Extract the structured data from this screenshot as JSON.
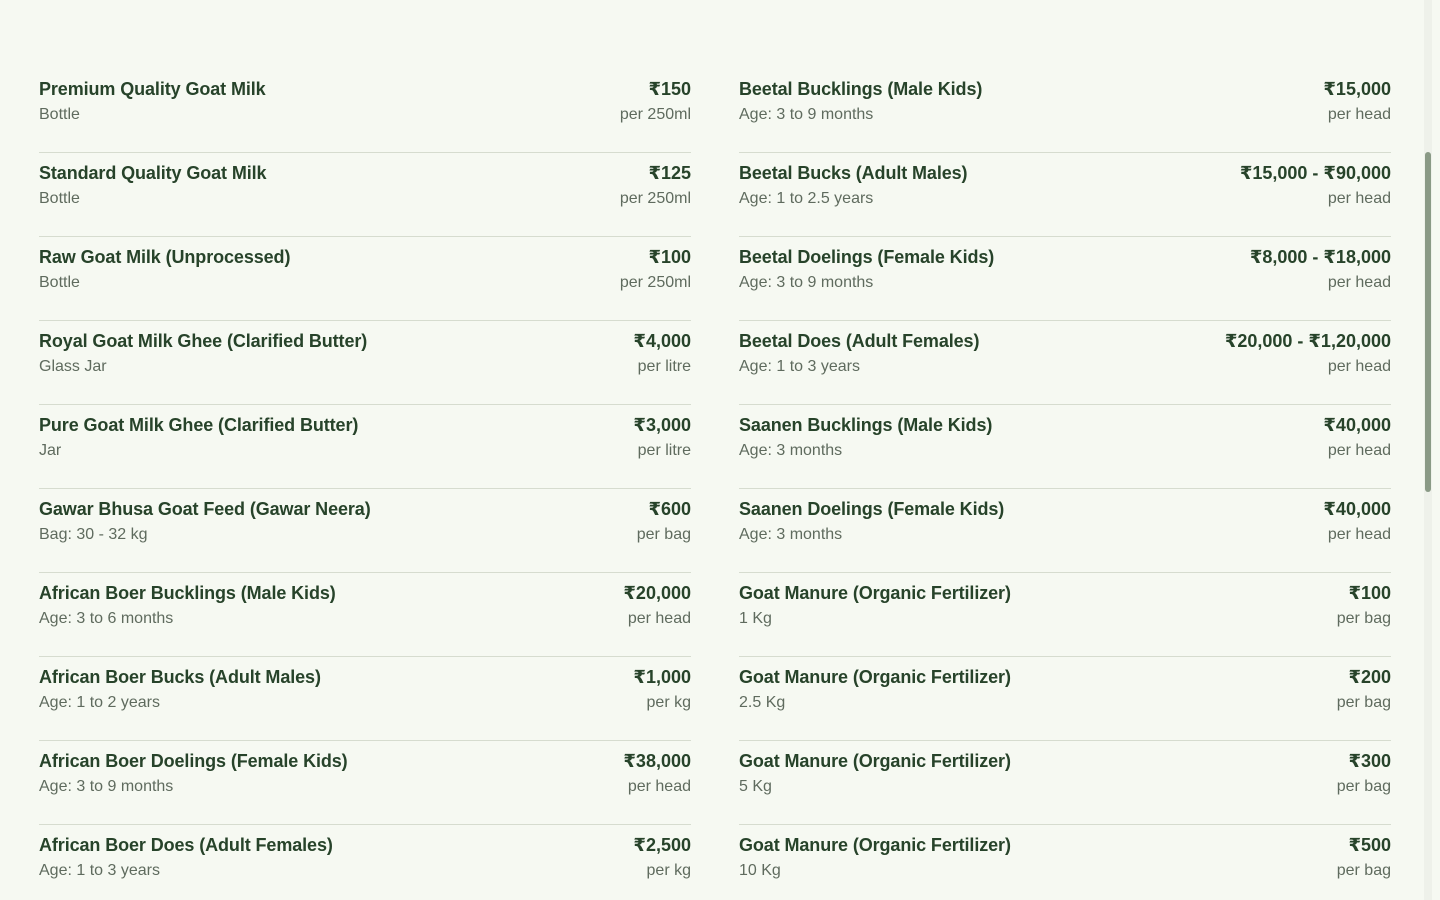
{
  "left_column": [
    {
      "name": "Premium Quality Goat Milk",
      "detail": "Bottle",
      "price": "₹150",
      "unit": "per 250ml"
    },
    {
      "name": "Standard Quality Goat Milk",
      "detail": "Bottle",
      "price": "₹125",
      "unit": "per 250ml"
    },
    {
      "name": "Raw Goat Milk (Unprocessed)",
      "detail": "Bottle",
      "price": "₹100",
      "unit": "per 250ml"
    },
    {
      "name": "Royal Goat Milk Ghee (Clarified Butter)",
      "detail": "Glass Jar",
      "price": "₹4,000",
      "unit": "per litre"
    },
    {
      "name": "Pure Goat Milk Ghee (Clarified Butter)",
      "detail": "Jar",
      "price": "₹3,000",
      "unit": "per litre"
    },
    {
      "name": "Gawar Bhusa Goat Feed (Gawar Neera)",
      "detail": "Bag: 30 - 32 kg",
      "price": "₹600",
      "unit": "per bag"
    },
    {
      "name": "African Boer Bucklings (Male Kids)",
      "detail": "Age: 3 to 6 months",
      "price": "₹20,000",
      "unit": "per head"
    },
    {
      "name": "African Boer Bucks (Adult Males)",
      "detail": "Age: 1 to 2 years",
      "price": "₹1,000",
      "unit": "per kg"
    },
    {
      "name": "African Boer Doelings (Female Kids)",
      "detail": "Age: 3 to 9 months",
      "price": "₹38,000",
      "unit": "per head"
    },
    {
      "name": "African Boer Does (Adult Females)",
      "detail": "Age: 1 to 3 years",
      "price": "₹2,500",
      "unit": "per kg"
    }
  ],
  "right_column": [
    {
      "name": "Beetal Bucklings (Male Kids)",
      "detail": "Age: 3 to 9 months",
      "price": "₹15,000",
      "unit": "per head"
    },
    {
      "name": "Beetal Bucks (Adult Males)",
      "detail": "Age: 1 to 2.5 years",
      "price": "₹15,000 - ₹90,000",
      "unit": "per head"
    },
    {
      "name": "Beetal Doelings (Female Kids)",
      "detail": "Age: 3 to 9 months",
      "price": "₹8,000 - ₹18,000",
      "unit": "per head"
    },
    {
      "name": "Beetal Does (Adult Females)",
      "detail": "Age: 1 to 3 years",
      "price": "₹20,000 - ₹1,20,000",
      "unit": "per head"
    },
    {
      "name": "Saanen Bucklings (Male Kids)",
      "detail": "Age: 3 months",
      "price": "₹40,000",
      "unit": "per head"
    },
    {
      "name": "Saanen Doelings (Female Kids)",
      "detail": "Age: 3 months",
      "price": "₹40,000",
      "unit": "per head"
    },
    {
      "name": "Goat Manure (Organic Fertilizer)",
      "detail": "1 Kg",
      "price": "₹100",
      "unit": "per bag"
    },
    {
      "name": "Goat Manure (Organic Fertilizer)",
      "detail": "2.5 Kg",
      "price": "₹200",
      "unit": "per bag"
    },
    {
      "name": "Goat Manure (Organic Fertilizer)",
      "detail": "5 Kg",
      "price": "₹300",
      "unit": "per bag"
    },
    {
      "name": "Goat Manure (Organic Fertilizer)",
      "detail": "10 Kg",
      "price": "₹500",
      "unit": "per bag"
    }
  ],
  "colors": {
    "background": "#f6f9f2",
    "text_primary": "#27432a",
    "text_secondary": "#5f6b5e",
    "divider": "#d6dccf"
  }
}
